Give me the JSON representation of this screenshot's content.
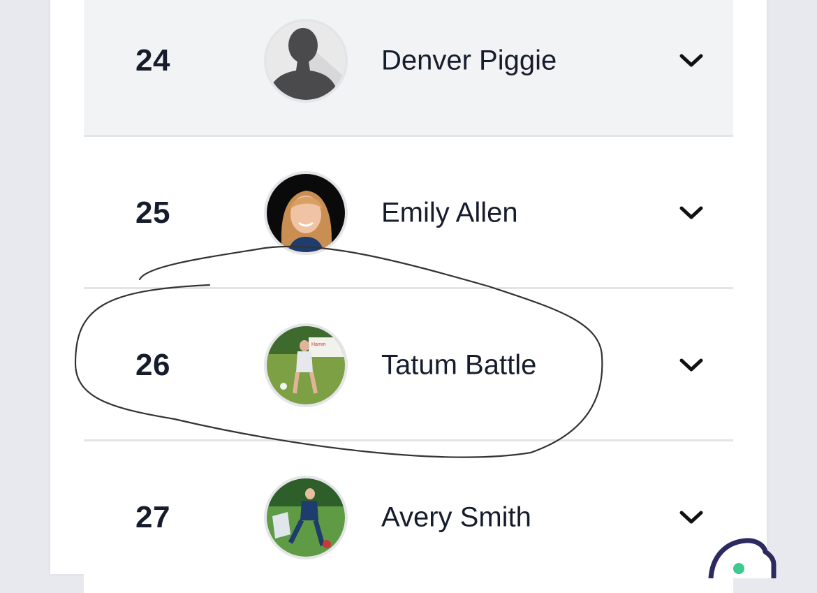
{
  "roster": {
    "players": [
      {
        "number": "24",
        "name": "Denver Piggie",
        "avatar": "default-silhouette-icon"
      },
      {
        "number": "25",
        "name": "Emily Allen",
        "avatar": "player-photo"
      },
      {
        "number": "26",
        "name": "Tatum Battle",
        "avatar": "player-photo"
      },
      {
        "number": "27",
        "name": "Avery Smith",
        "avatar": "player-photo"
      }
    ]
  },
  "icons": {
    "expand": "chevron-down-icon",
    "chat": "chat-bubble-icon"
  },
  "colors": {
    "text": "#161c2c",
    "highlight_row": "#f2f3f5",
    "annotation": "#333333",
    "widget_accent": "#3ec98f"
  }
}
